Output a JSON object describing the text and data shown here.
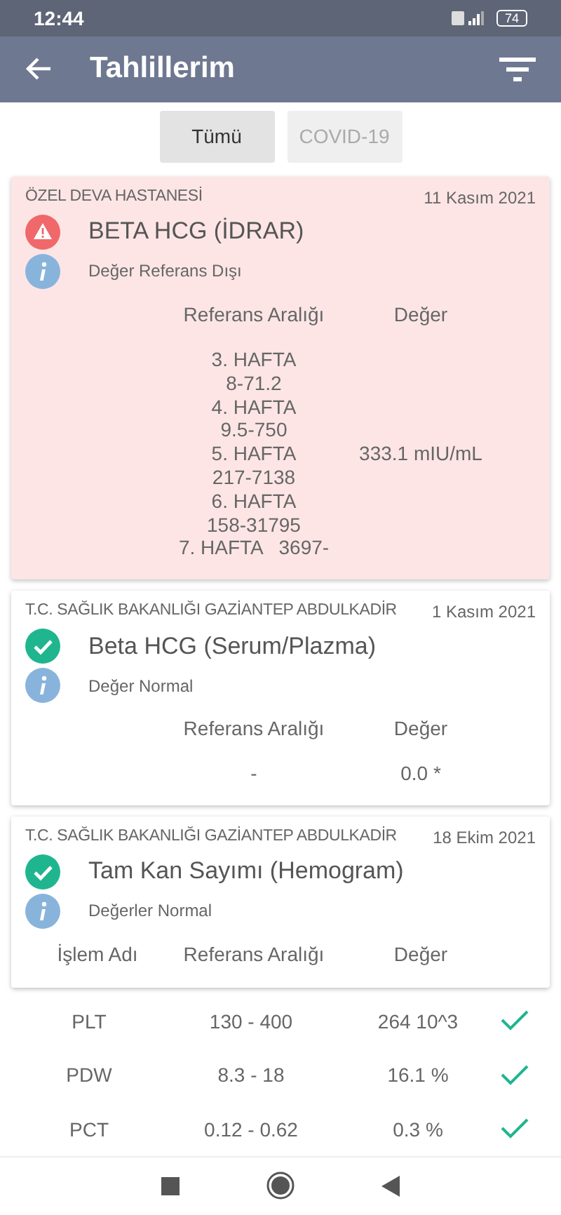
{
  "status_bar": {
    "time": "12:44",
    "battery": "74"
  },
  "app_bar": {
    "title": "Tahlillerim"
  },
  "filters": [
    {
      "label": "Tümü",
      "selected": true
    },
    {
      "label": "COVID-19",
      "selected": false
    }
  ],
  "cards": [
    {
      "hospital": "ÖZEL DEVA HASTANESİ",
      "date": "11 Kasım 2021",
      "kind": "abnormal",
      "title": "BETA HCG (İDRAR)",
      "note": "Değer Referans Dışı",
      "columns": [
        "Referans Aralığı",
        "Değer"
      ],
      "rows": [
        {
          "reference": "3. HAFTA\n8-71.2\n4. HAFTA\n9.5-750\n5. HAFTA\n217-7138\n6. HAFTA\n158-31795\n7. HAFTA   3697-",
          "value": "333.1 mIU/mL"
        }
      ]
    },
    {
      "hospital": "T.C. SAĞLIK BAKANLIĞI GAZİANTEP ABDULKADİR",
      "date": "1 Kasım 2021",
      "kind": "normal",
      "title": "Beta HCG (Serum/Plazma)",
      "note": "Değer Normal",
      "columns": [
        "Referans Aralığı",
        "Değer"
      ],
      "rows": [
        {
          "reference": "-",
          "value": "0.0 *"
        }
      ]
    },
    {
      "hospital": "T.C. SAĞLIK BAKANLIĞI GAZİANTEP ABDULKADİR",
      "date": "18 Ekim 2021",
      "kind": "normal",
      "title": "Tam Kan Sayımı (Hemogram)",
      "note": "Değerler Normal",
      "columns": [
        "İşlem Adı",
        "Referans Aralığı",
        "Değer"
      ]
    }
  ],
  "results": [
    {
      "name": "PLT",
      "reference": "130 - 400",
      "value": "264 10^3",
      "normal": true
    },
    {
      "name": "PDW",
      "reference": "8.3 - 18",
      "value": "16.1 %",
      "normal": true
    },
    {
      "name": "PCT",
      "reference": "0.12 - 0.62",
      "value": "0.3 %",
      "normal": true
    }
  ]
}
